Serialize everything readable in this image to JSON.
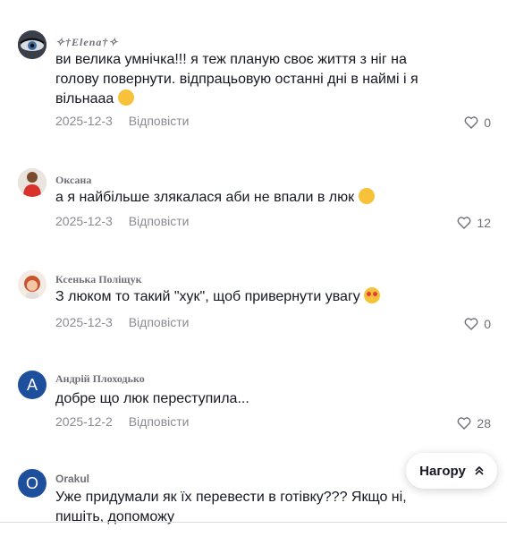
{
  "comments": [
    {
      "author": "✧†Elena†✧",
      "text": "ви велика умнічка!!! я теж планую своє життя з ніг на голову повернути. відпрацьовую останні дні в наймі і я вільнааа",
      "date": "2025-12-3",
      "reply": "Відповісти",
      "likes": "0"
    },
    {
      "author": "Оксана",
      "text": "а я найбільше злякалася аби не впали в люк",
      "date": "2025-12-3",
      "reply": "Відповісти",
      "likes": "12"
    },
    {
      "author": "Ксенька Поліщук",
      "text": "З люком то такий \"хук\", щоб привернути увагу",
      "date": "2025-12-3",
      "reply": "Відповісти",
      "likes": "0"
    },
    {
      "author": "Андрій Плоходько",
      "avatar_letter": "A",
      "text": "добре що люк переступила...",
      "date": "2025-12-2",
      "reply": "Відповісти",
      "likes": "28"
    },
    {
      "author": "Orakul",
      "avatar_letter": "O",
      "text": "Уже придумали як їх перевести в готівку??? Якщо ні, пишіть, допоможу"
    }
  ],
  "scroll_top": {
    "label": "Нагору"
  },
  "colors": {
    "avatar_blue": "#1e4f9c",
    "meta_gray": "#8a8b91"
  }
}
